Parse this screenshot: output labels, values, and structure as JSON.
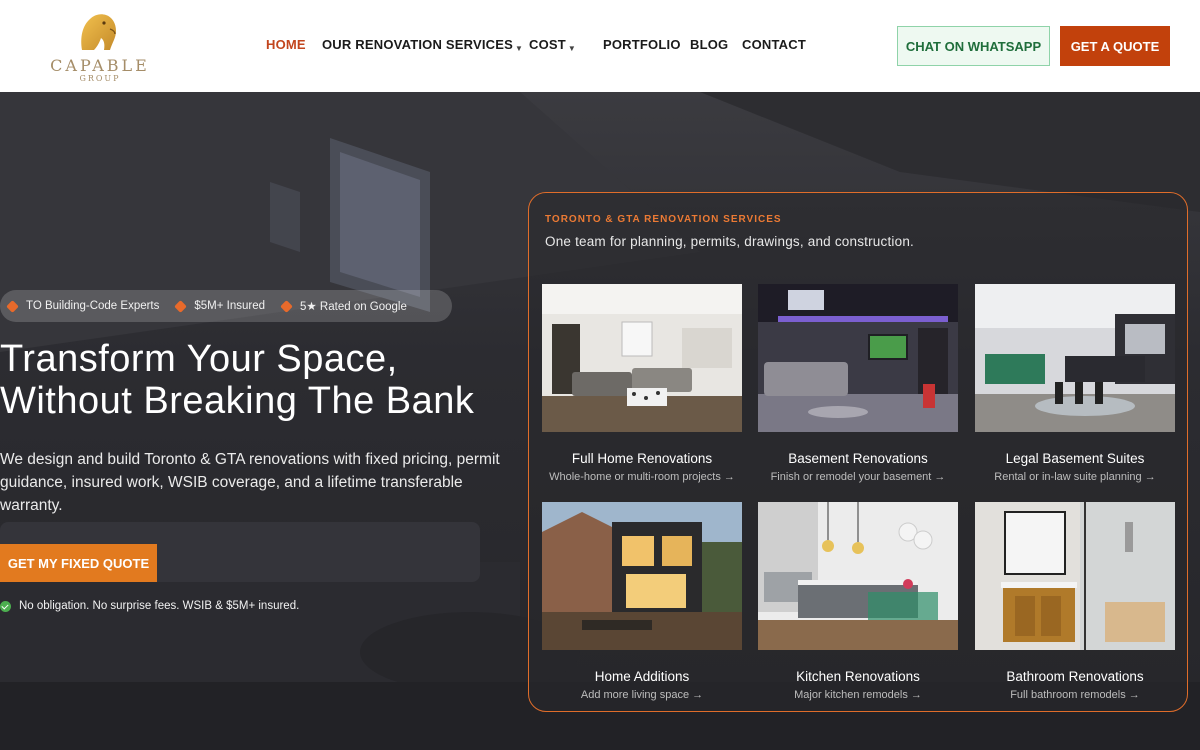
{
  "brand": {
    "name": "CAPABLE",
    "sub": "GROUP"
  },
  "nav": {
    "items": [
      {
        "label": "HOME",
        "active": true
      },
      {
        "label": "OUR RENOVATION SERVICES",
        "caret": true
      },
      {
        "label": "COST",
        "caret": true
      },
      {
        "label": "PORTFOLIO"
      },
      {
        "label": "BLOG"
      },
      {
        "label": "CONTACT"
      }
    ]
  },
  "header": {
    "whatsapp_label": "CHAT ON WHATSAPP",
    "quote_label": "GET A QUOTE"
  },
  "hero": {
    "trust": [
      "TO Building-Code Experts",
      "$5M+ Insured",
      "5★ Rated on Google"
    ],
    "title": "Transform Your Space, Without Breaking The Bank",
    "subtitle": "We design and build Toronto & GTA renovations with fixed pricing, permit guidance, insured work, WSIB coverage, and a lifetime transferable warranty.",
    "cta_label": "GET MY FIXED QUOTE",
    "note": "No obligation. No surprise fees. WSIB & $5M+ insured."
  },
  "services": {
    "eyebrow": "TORONTO & GTA RENOVATION SERVICES",
    "lead": "One team for planning, permits, drawings, and construction.",
    "cards": [
      {
        "title": "Full Home Renovations",
        "desc": "Whole-home or multi-room projects →"
      },
      {
        "title": "Basement Renovations",
        "desc": "Finish or remodel your basement →"
      },
      {
        "title": "Legal Basement Suites",
        "desc": "Rental or in-law suite planning →"
      },
      {
        "title": "Home Additions",
        "desc": "Add more living space →"
      },
      {
        "title": "Kitchen Renovations",
        "desc": "Major kitchen remodels →"
      },
      {
        "title": "Bathroom Renovations",
        "desc": "Full bathroom remodels →"
      }
    ]
  },
  "colors": {
    "accent": "#c2410c",
    "orange": "#e27a1f",
    "whatsapp": "#1f6e3b",
    "panel_border": "#e06d2a"
  }
}
